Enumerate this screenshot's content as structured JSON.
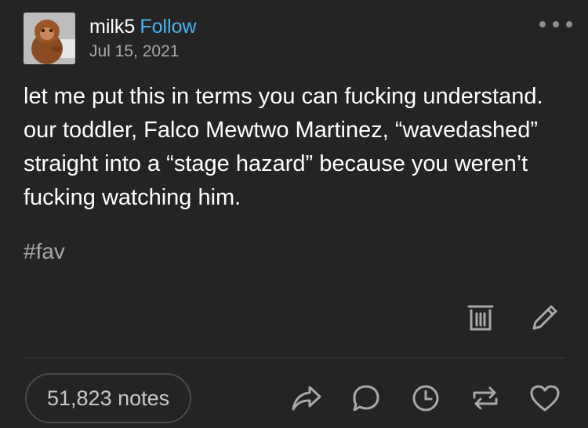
{
  "post": {
    "username": "milk5",
    "follow_label": "Follow",
    "date": "Jul 15, 2021",
    "body": "let me put this in terms you can fucking understand. our toddler, Falco Mewtwo Martinez, “wavedashed” straight into a “stage hazard” because you weren’t fucking watching him.",
    "tag": "#fav",
    "notes_label": "51,823 notes"
  },
  "icons": {
    "more": "more-options-icon",
    "delete": "trash-icon",
    "edit": "pencil-icon",
    "share": "share-icon",
    "reply": "reply-bubble-icon",
    "schedule": "clock-icon",
    "reblog": "reblog-icon",
    "like": "heart-icon"
  },
  "colors": {
    "background": "#242424",
    "accent": "#4ab3f4",
    "muted": "#a8a8a8"
  }
}
